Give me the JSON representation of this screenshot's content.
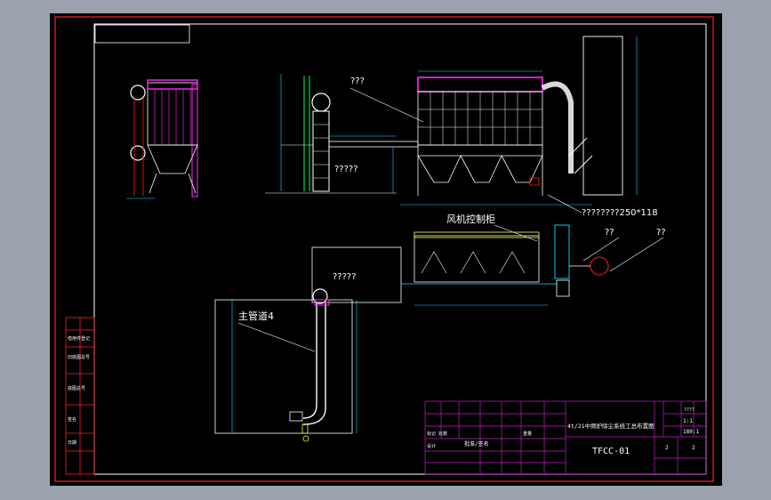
{
  "drawing": {
    "labels": {
      "unknown_a": "???",
      "unknown_b": "?????",
      "fan_cabinet": "风机控制柜",
      "pipe_spec": "????????250*118",
      "unknown_c": "??",
      "unknown_d": "??",
      "unknown_e": "?????",
      "main_pipe": "主管道4"
    }
  },
  "title_block": {
    "title": "4t/21中频炉除尘系统工总布置图",
    "drawing_no": "TFCC-01",
    "scale": "1:1",
    "ratio": "180:1",
    "sheet_a": "2",
    "sheet_b": "2",
    "label_mid": "重量",
    "label_left": "标记 处数",
    "label_left2": "设计",
    "stamp": "批准/签名",
    "unknown_top": "????"
  },
  "margin_labels": [
    "借用件登记",
    "旧底图总号",
    "底图总号",
    "签名",
    "日期"
  ],
  "colors": {
    "frame_red": "#ff2020",
    "dust_magenta": "#ff2bff",
    "structure_white": "#ffffff",
    "dimension_cyan": "#00e5ff",
    "equipment_yellow": "#ffff40",
    "title_grid_magenta": "#c020c0"
  }
}
